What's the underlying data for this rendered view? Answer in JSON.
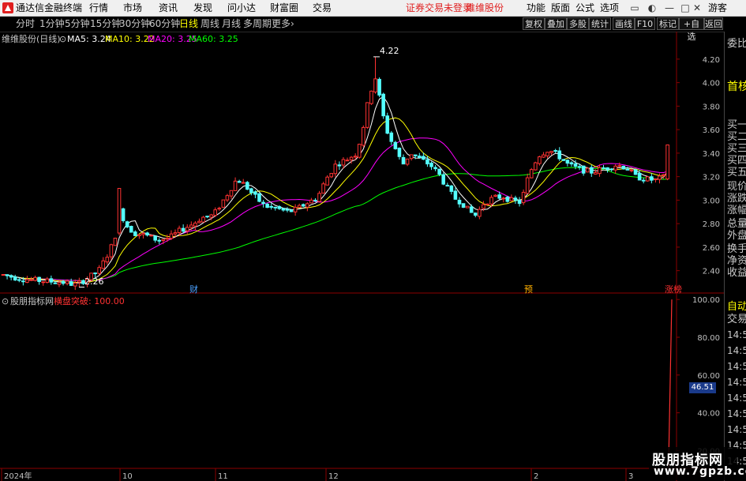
{
  "app": {
    "title": "通达信金融终端"
  },
  "menu": [
    "行情",
    "市场",
    "资讯",
    "发现",
    "问小达",
    "财富圈",
    "交易"
  ],
  "login_notice": "证券交易未登录",
  "stock_link": "维维股份",
  "menu_right": [
    "功能",
    "版面",
    "公式",
    "选项"
  ],
  "guest": "游客",
  "periods": [
    "分时",
    "1分钟",
    "5分钟",
    "15分钟",
    "30分钟",
    "60分钟",
    "日线",
    "周线",
    "月线",
    "多周期",
    "更多"
  ],
  "active_period": "日线",
  "toolbar_buttons": [
    "复权",
    "叠加",
    "多股",
    "统计",
    "画线",
    "F10",
    "标记",
    "+自选",
    "返回"
  ],
  "main_legend": {
    "stock": "维维股份(日线)",
    "ma": [
      {
        "label": "MA5: 3.24",
        "color": "#ffffff"
      },
      {
        "label": "MA10: 3.22",
        "color": "#ffff00"
      },
      {
        "label": "MA20: 3.25",
        "color": "#ff00ff"
      },
      {
        "label": "MA60: 3.25",
        "color": "#00ff00"
      }
    ]
  },
  "annotations": {
    "high": "4.22",
    "low": "2.26",
    "marker_cai": "财",
    "marker_yu": "预",
    "marker_zhangting": "涨榜"
  },
  "sub_legend": {
    "name": "股朋指标网",
    "indicator": "横盘突破: 100.00"
  },
  "right_panel": [
    "委比",
    "首核",
    "买一",
    "买二",
    "买三",
    "买四",
    "买五",
    "现价",
    "涨跌",
    "涨幅",
    "总量",
    "外盘",
    "换手",
    "净资",
    "收益",
    "自动",
    "交易",
    "14:5",
    "14:5",
    "14:5",
    "14:5",
    "14:5",
    "14:5",
    "14:5",
    "14:5",
    "14:5"
  ],
  "sub_value_tag": "46.51",
  "x_labels": [
    "2024年",
    "10",
    "11",
    "12",
    "2",
    "3"
  ],
  "watermark": {
    "line1": "股朋指标网",
    "line2": "www.7gpzb.com"
  },
  "colors": {
    "up": "#ff3232",
    "down": "#54ffff",
    "ma5": "#ffffff",
    "ma10": "#ffff00",
    "ma20": "#ff00ff",
    "ma60": "#00ff00"
  },
  "chart_data": {
    "type": "line",
    "main": {
      "y_ticks": [
        "4.20",
        "4.00",
        "3.80",
        "3.60",
        "3.40",
        "3.20",
        "3.00",
        "2.80",
        "2.60",
        "2.40"
      ],
      "ylim": [
        2.27,
        4.3
      ],
      "ma5_last": 3.24,
      "ma10_last": 3.22,
      "ma20_last": 3.25,
      "ma60_last": 3.25,
      "high": 4.22,
      "low": 2.26
    },
    "sub": {
      "y_ticks": [
        "100.00",
        "80.00",
        "60.00",
        "40.00",
        "20.00"
      ],
      "ylim": [
        11,
        103
      ],
      "last_value": 100.0
    }
  }
}
